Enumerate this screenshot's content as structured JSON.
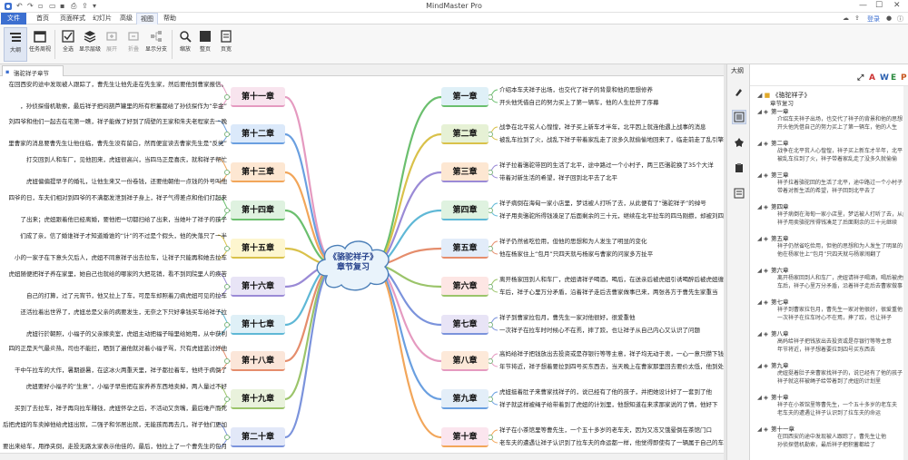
{
  "app": {
    "title": "MindMaster Pro"
  },
  "menu": {
    "file": "文件",
    "items": [
      "首页",
      "页面样式",
      "幻灯片",
      "高级",
      "视图",
      "帮助"
    ]
  },
  "account": {
    "login": "登录"
  },
  "ribbon": {
    "buttons": [
      "大纲",
      "任务周视",
      "全选",
      "显示层级",
      "展开",
      "折叠",
      "显示分支",
      "缩放",
      "整页",
      "页宽"
    ]
  },
  "tab": {
    "label": "骆驼祥子章节"
  },
  "center": {
    "line1": "《骆驼祥子》",
    "line2": "章节复习"
  },
  "left_chapters": [
    {
      "title": "第十一章",
      "note1": "在回西安的途中发现被人跟踪了，曹先生让他先走在先生家，然后要他到曹家报信。",
      "note2": "，孙侦探借机勒索，最后祥子把闷葫芦罐里的所有积蓄都给了孙侦探作为“辛金”"
    },
    {
      "title": "第十二章",
      "note1": "刘四爷和他们一起去在宅第一瞧，祥子能做了好到了隔壁的王家和朱夫老程家去一晚",
      "note2": "里曹家的消息要曹先生让他住临，曹先生没有留白，然而便宣读去曹家先生是“反党”"
    },
    {
      "title": "第十三章",
      "note1": "打交回到人和车厂，见他回来，虎妞很高兴，当四马正是喜庆，就和祥子帮忙",
      "note2": "虎妞偏偏提早子的婚礼，让他生来又一份卷钱，还要他朝他一点钱的外号叫他"
    },
    {
      "title": "第十四章",
      "note1": "四爷的日，车夫们相对到四爷的不满都发泄到祥子身上，祥子气得差点和他们打起来",
      "note2": "了出来；虎妞跟着他已经离婚，要他把一切都扫给了出来，当她叶了祥子的孩子"
    },
    {
      "title": "第十五章",
      "note1": "们成了亲，信了婚谁祥子才知道婚谁的“计”的不过是个假头，他的失落只了一半",
      "note2": "小的一家子在下意头欠后人，虎妞不同意祥子出去拉车，让祥子只能再和她去拉车"
    },
    {
      "title": "第十六章",
      "note1": "虎妞随便把祥子养在家里，她自己也就给的哪家的大把花销，看不到同院里人的疾苦",
      "note2": "自己的打算，过了元宵节，他又拉上了车，可是车却照着刀病虎妞可见的拉车"
    },
    {
      "title": "第十七章",
      "note1": "还活拉着出世界了，虎妞总是父亲的病要发生，无奈之下只好拿钱买车给祥子拉",
      "note2": "虎妞行於朝照，小福子的父亲嫁卖室，虎妞主动把福子暗里给她用，从中获利"
    },
    {
      "title": "第十八章",
      "note1": "四的正是天气最炎热，司也不能拦，晒到了遍他就对着小福子骂，只有虎妞蓝讨好他",
      "note2": "干中午拉车的大作，暑期避暑，在这冰火两重天里，祥子都拉着车，他终于病倒了"
    },
    {
      "title": "第十九章",
      "note1": "虎妞要好小福子的“生意”，小福子早些把在家养养东西地卖掉，两人量过不好",
      "note2": "买到了去拉车，祥子再向拉车赚钱，虎妞怀孕之后，不活动又贪嘴，最后难产而死"
    },
    {
      "title": "第二十章",
      "note1": "后把虎妞的车卖掉他给虎妞出殡，二强子和邻居出殡，无能孩而再去几，祥子他们更加",
      "note2": "要出来给车，用挣夹倒，走投无路太家表示他佳的，最后，他拉上了一个曹先生的包月"
    }
  ],
  "right_chapters": [
    {
      "title": "第一章",
      "note1": "介绍本车夫祥子出场，也交代了祥子的背景和他的思想修养",
      "note2": "开头他凭借自己的努力买上了第一辆车，他的人生拉开了序幕"
    },
    {
      "title": "第二章",
      "note1": "战争在北平贫人心惶惶，祥子买上新车才半年，北平因上就连他遇上战事的消息",
      "note2": "被乱车拉到了火，战乱下祥子带着家乱走了没多久就偷偷地回来了，临走前走了乱引擎兵逃跑"
    },
    {
      "title": "第三章",
      "note1": "祥子拉着骆驼带回的生活了北平，途中路过一个小村子，两三匹骆驼换了35个大洋",
      "note2": "带着对新生活的希望，祥子回到北平去了北平"
    },
    {
      "title": "第四章",
      "note1": "祥子病倒在海甸一家小店里，梦话被人打听了去，从此便有了“骆驼祥子”的绰号",
      "note2": "祥子用卖骆驼所得钱凑足了后面剩余的三十元，继续在北平拉车的四马刚攒，却被刘四爷的拉车"
    },
    {
      "title": "第五章",
      "note1": "祥子仍然省吃俭用，但他的思想和为人发生了明显的变化",
      "note2": "他在杨家住上“包月”只四天就与杨家与曹家的问家多方扯平"
    },
    {
      "title": "第六章",
      "note1": "离开杨家回到人和车厂，虎妞请祥子喝酒，喝后，在送亲后被虎妞引诱喝醉后被虎妞缠上了",
      "note2": "车后，祥子心里万分矛盾，沿着祥子走后去曹家做事已来，两张各方于曹先生家重当"
    },
    {
      "title": "第七章",
      "note1": "祥子到曹家拉包月，曹先生一家对他很好，很爱重他",
      "note2": "一次祥子在拉车时时候心不在焉，摔了跤，也让祥子从自己内心又认识了问题"
    },
    {
      "title": "第八章",
      "note1": "高妈给祥子把钱放出去投资或是存银行等等主意，祥子均无动于衷，一心一意只攒下钱",
      "note2": "年节将近，祥子想着要拉到四号买东西去，当天晚上在曹家那里回去要价太低，他到处打听"
    },
    {
      "title": "第九章",
      "note1": "虎妞挺着肚子来曹家找祥子的，说已经有了他的孩子，并把她设计好了一套到了他",
      "note2": "祥子就这样被绳子给带着到了虎妞的计划里，他想知道在来求那家说的了情，他好下"
    },
    {
      "title": "第十章",
      "note1": "祥子在小茶馆里等曹先生，一个五十多岁的老车夫，因为又冻又饿晕倒在茶馆门口",
      "note2": "老车夫的遭遇让祥子认识到了拉车夫的命运都一样，他觉得即使有了一辆属于自己的车，到老来也"
    }
  ],
  "outline": {
    "tools": [
      "⤢",
      "A",
      "W",
      "E",
      "P"
    ],
    "root": "《骆驼祥子》",
    "root_sub": "章节复习",
    "items": [
      {
        "title": "第一章",
        "n1": "介绍车夫祥子出场，也交代了祥子的背景和他的思想",
        "n2": "开头他凭借自己的努力买上了第一辆车，他的人生"
      },
      {
        "title": "第二章",
        "n1": "战争在北平贫人心惶惶，祥子买上新车才半年，北平",
        "n2": "被乱车拉到了火，祥子带着家乱走了没多久就偷偷"
      },
      {
        "title": "第三章",
        "n1": "祥子拉着骆驼回的生活了北平，途中路过一个小村子，",
        "n2": "带着对新生活的希望，祥子回到北平去了"
      },
      {
        "title": "第四章",
        "n1": "祥子病倒在海甸一家小店里，梦话被人打听了去，从此",
        "n2": "祥子用卖骆驼所得钱凑足了后面剩余的三十元继续"
      },
      {
        "title": "第五章",
        "n1": "祥子仍然省吃俭用，但他的思想和为人发生了明显的",
        "n2": "他在杨家住上“包月”只四天就与杨家闹翻了"
      },
      {
        "title": "第六章",
        "n1": "离开杨家回到人和车厂，虎妞请祥子喝酒，喝后被虎妞",
        "n2": "车后，祥子心里万分矛盾，沿着祥子走后去曹家做事"
      },
      {
        "title": "第七章",
        "n1": "祥子到曹家拉包月，曹先生一家对他很好，很爱重他",
        "n2": "一次祥子在拉车时心不在焉，摔了跤，也让祥子"
      },
      {
        "title": "第八章",
        "n1": "高妈给祥子把钱放出去投资或是存银行等等主意",
        "n2": "年节将近，祥子想着要拉到四号买东西去"
      },
      {
        "title": "第九章",
        "n1": "虎妞挺着肚子来曹家找祥子的，说已经有了他的孩子",
        "n2": "祥子就这样被绳子给带着到了虎妞的计划里"
      },
      {
        "title": "第十章",
        "n1": "祥子在小茶馆里等曹先生，一个五十多岁的老车夫",
        "n2": "老车夫的遭遇让祥子认识到了拉车夫的命运"
      },
      {
        "title": "第十一章",
        "n1": "在回西安的途中发现被人跟踪了，曹先生让他",
        "n2": "孙侦探借机勒索，最后祥子把积蓄都给了"
      }
    ]
  },
  "sidebar": {
    "title": "大纲"
  },
  "colors": {
    "accent": "#3c6fd0"
  }
}
